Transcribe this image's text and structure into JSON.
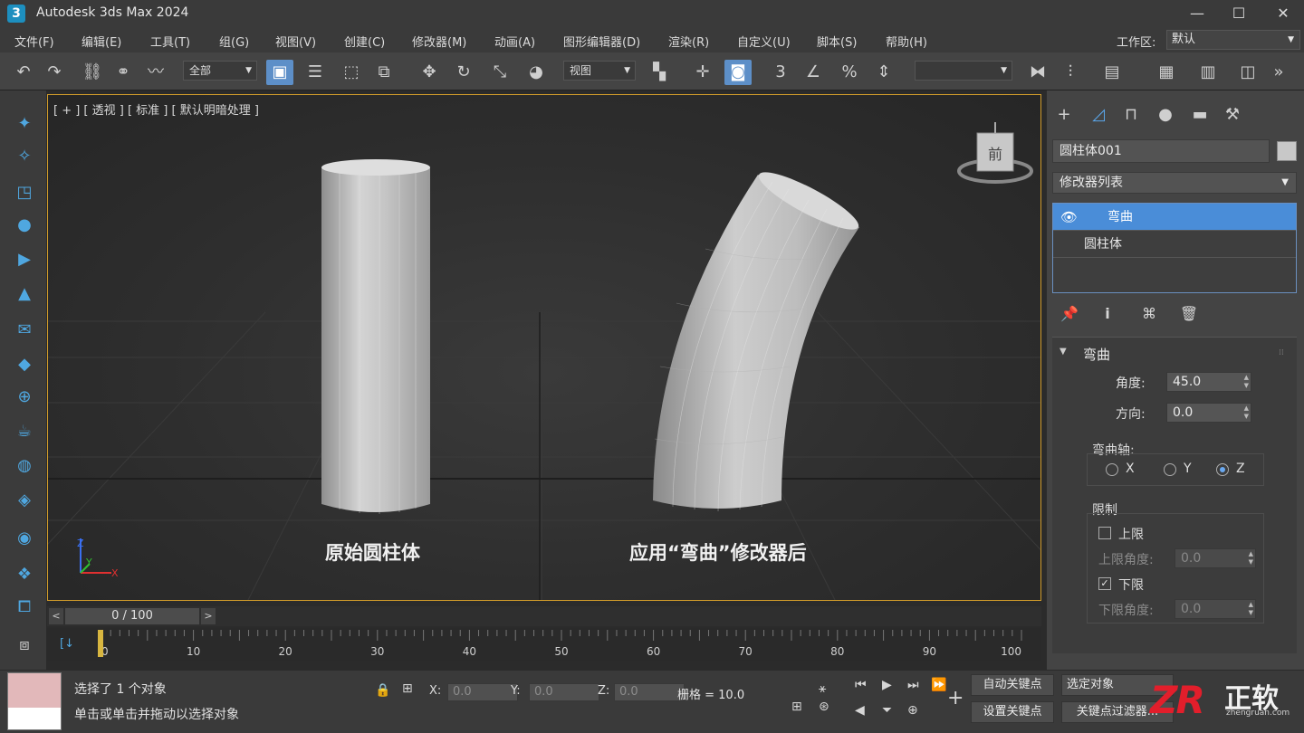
{
  "window": {
    "app_icon": "3",
    "title": "Autodesk 3ds Max 2024",
    "controls": [
      "—",
      "☐",
      "✕"
    ]
  },
  "menu": [
    "文件(F)",
    "编辑(E)",
    "工具(T)",
    "组(G)",
    "视图(V)",
    "创建(C)",
    "修改器(M)",
    "动画(A)",
    "图形编辑器(D)",
    "渲染(R)",
    "自定义(U)",
    "脚本(S)",
    "帮助(H)"
  ],
  "workspace": {
    "label": "工作区:",
    "value": "默认"
  },
  "toolbar": {
    "selection_filter": "全部",
    "ref_coord": "视图"
  },
  "viewport": {
    "label": "[ + ] [ 透视 ] [ 标准 ] [ 默认明暗处理 ]",
    "viewcube_face": "前",
    "caption_left": "原始圆柱体",
    "caption_right": "应用“弯曲”修改器后",
    "axis_labels": {
      "x": "X",
      "y": "Y",
      "z": "Z"
    }
  },
  "timeslider": {
    "value": "0 / 100",
    "prev": "<",
    "next": ">"
  },
  "trackbar": {
    "ticks": [
      "0",
      "10",
      "20",
      "30",
      "40",
      "50",
      "60",
      "70",
      "80",
      "90",
      "100"
    ],
    "icon": "[↓"
  },
  "command_panel": {
    "object_name": "圆柱体001",
    "modifier_list": "修改器列表",
    "stack": [
      {
        "label": "弯曲",
        "selected": true
      },
      {
        "label": "圆柱体",
        "selected": false
      }
    ],
    "rollout": {
      "title": "弯曲",
      "angle_label": "角度:",
      "angle_value": "45.0",
      "direction_label": "方向:",
      "direction_value": "0.0",
      "axis_label": "弯曲轴:",
      "axes": [
        "X",
        "Y",
        "Z"
      ],
      "axis_selected": "Z",
      "limits_label": "限制",
      "upper_label": "上限",
      "upper_checked": false,
      "upper_angle_label": "上限角度:",
      "upper_angle_value": "0.0",
      "lower_label": "下限",
      "lower_checked": true,
      "lower_angle_label": "下限角度:",
      "lower_angle_value": "0.0"
    }
  },
  "status": {
    "selected_text": "选择了 1 个对象",
    "hint_text": "单击或单击并拖动以选择对象",
    "x_label": "X:",
    "x_value": "0.0",
    "y_label": "Y:",
    "y_value": "0.0",
    "z_label": "Z:",
    "z_value": "0.0",
    "grid_text": "栅格 = 10.0",
    "auto_key": "自动关键点",
    "set_key": "设置关键点",
    "selected_object": "选定对象",
    "key_filter": "关键点过滤器..."
  },
  "watermark": {
    "brand": "ZR",
    "name": "正软",
    "url": "zhengruan.com"
  },
  "colors": {
    "accent": "#4a8dd8",
    "viewport_border": "#d09b2a",
    "brand_red": "#e21e2b"
  }
}
